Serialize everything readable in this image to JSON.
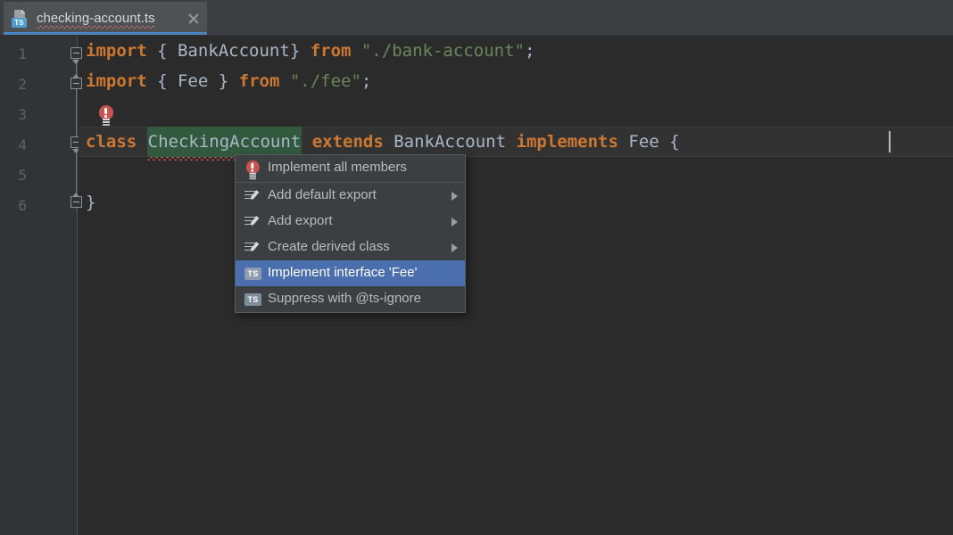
{
  "window": {
    "theme": "darcula",
    "colors": {
      "editor_bg": "#2b2b2b",
      "gutter_bg": "#313335",
      "tabbar_bg": "#3c3f41",
      "tab_active_bg": "#4e5254",
      "tab_underline": "#4a88c7",
      "menu_bg": "#3c3f41",
      "menu_selection": "#4b6eaf",
      "keyword": "#cc7832",
      "string": "#6a8759",
      "identifier": "#a9b7c6",
      "error_squiggle": "#c75450",
      "identifier_highlight": "#32593d"
    }
  },
  "tab": {
    "filename": "checking-account.ts",
    "file_icon": "typescript-file-icon",
    "file_icon_badge": "TS",
    "close_icon": "close-icon",
    "has_error_underline": true
  },
  "editor": {
    "line_numbers": [
      "1",
      "2",
      "3",
      "4",
      "5",
      "6"
    ],
    "lines": [
      {
        "number": "1",
        "tokens": [
          {
            "text": "import",
            "type": "kw"
          },
          {
            "text": " { ",
            "type": "pun"
          },
          {
            "text": "BankAccount",
            "type": "idn"
          },
          {
            "text": "} ",
            "type": "pun"
          },
          {
            "text": "from",
            "type": "kw"
          },
          {
            "text": " ",
            "type": "pun"
          },
          {
            "text": "\"./bank-account\"",
            "type": "str"
          },
          {
            "text": ";",
            "type": "pun"
          }
        ],
        "plain": "import { BankAccount} from \"./bank-account\";"
      },
      {
        "number": "2",
        "tokens": [
          {
            "text": "import",
            "type": "kw"
          },
          {
            "text": " { ",
            "type": "pun"
          },
          {
            "text": "Fee",
            "type": "idn"
          },
          {
            "text": " } ",
            "type": "pun"
          },
          {
            "text": "from",
            "type": "kw"
          },
          {
            "text": " ",
            "type": "pun"
          },
          {
            "text": "\"./fee\"",
            "type": "str"
          },
          {
            "text": ";",
            "type": "pun"
          }
        ],
        "plain": "import { Fee } from \"./fee\";"
      },
      {
        "number": "3",
        "tokens": [],
        "plain": ""
      },
      {
        "number": "4",
        "tokens": [],
        "plain": "class CheckingAccount extends BankAccount implements Fee {",
        "is_current_line": true
      },
      {
        "number": "5",
        "tokens": [],
        "plain": ""
      },
      {
        "number": "6",
        "tokens": [
          {
            "text": "}",
            "type": "pun"
          }
        ],
        "plain": "}"
      }
    ],
    "line4": {
      "kw_class": "class",
      "class_name": "CheckingAccount",
      "kw_extends": "extends",
      "super_class": "BankAccount",
      "kw_implements": "implements",
      "interface_name": "Fee",
      "open_brace": "{"
    },
    "gutter_icons": {
      "error_bulb": "error-lightbulb-icon",
      "fold_marker": "code-fold-marker-icon"
    }
  },
  "intention_menu": {
    "items": [
      {
        "label": "Implement all members",
        "icon": "error-lightbulb-icon",
        "icon_type": "bulb",
        "has_submenu": false,
        "selected": false,
        "separator_after": true
      },
      {
        "label": "Add default export",
        "icon": "quickfix-icon",
        "icon_type": "quickfix",
        "has_submenu": true,
        "selected": false,
        "separator_after": false
      },
      {
        "label": "Add export",
        "icon": "quickfix-icon",
        "icon_type": "quickfix",
        "has_submenu": true,
        "selected": false,
        "separator_after": false
      },
      {
        "label": "Create derived class",
        "icon": "quickfix-icon",
        "icon_type": "quickfix",
        "has_submenu": true,
        "selected": false,
        "separator_after": false
      },
      {
        "label": "Implement interface 'Fee'",
        "icon": "typescript-badge-icon",
        "icon_type": "ts",
        "icon_badge": "TS",
        "has_submenu": false,
        "selected": true,
        "separator_after": false
      },
      {
        "label": "Suppress with @ts-ignore",
        "icon": "typescript-badge-icon",
        "icon_type": "ts",
        "icon_badge": "TS",
        "has_submenu": false,
        "selected": false,
        "separator_after": false
      }
    ]
  }
}
